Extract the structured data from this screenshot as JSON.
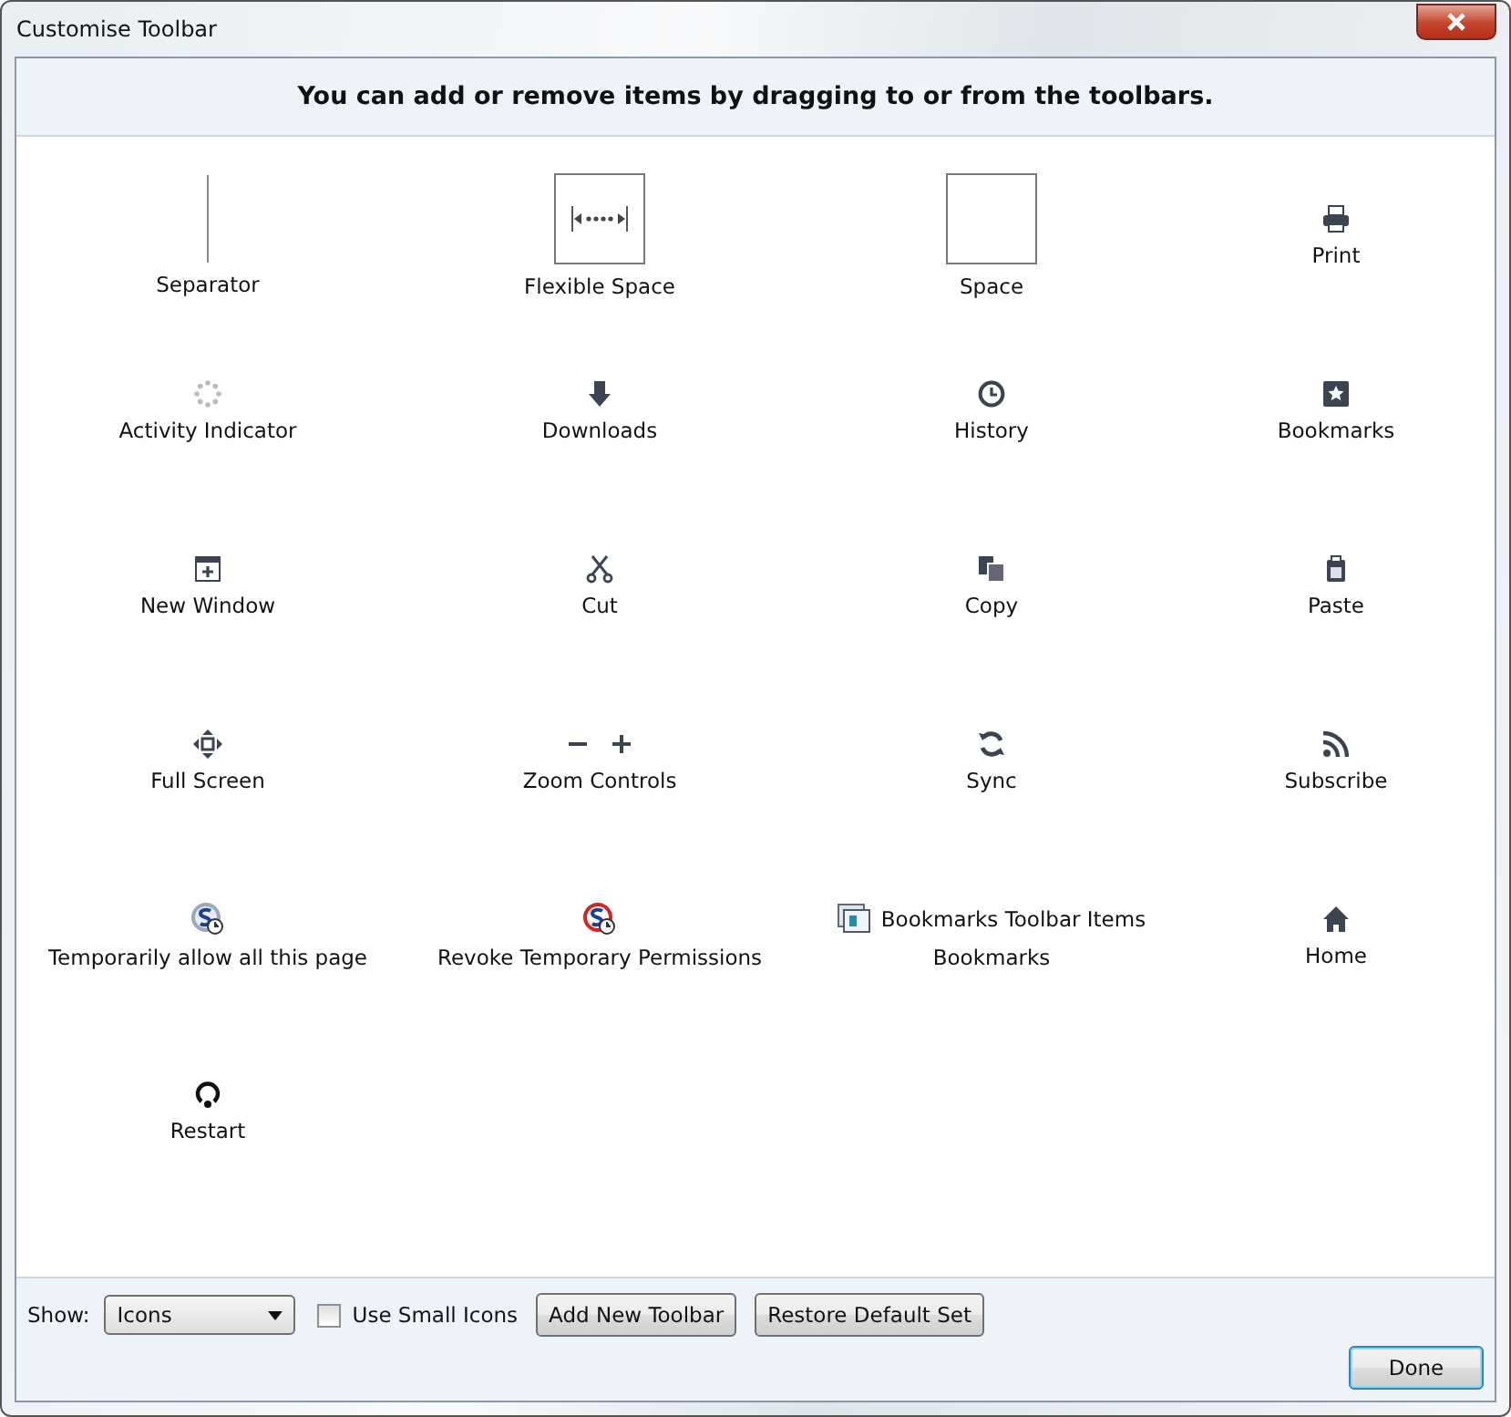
{
  "window": {
    "title": "Customise Toolbar"
  },
  "instructions": "You can add or remove items by dragging to or from the toolbars.",
  "items": [
    {
      "kind": "separator",
      "label": "Separator"
    },
    {
      "kind": "flexible-space",
      "label": "Flexible Space"
    },
    {
      "kind": "space",
      "label": "Space"
    },
    {
      "kind": "print",
      "label": "Print"
    },
    {
      "kind": "spinner",
      "label": "Activity Indicator"
    },
    {
      "kind": "download",
      "label": "Downloads"
    },
    {
      "kind": "clock",
      "label": "History"
    },
    {
      "kind": "star",
      "label": "Bookmarks"
    },
    {
      "kind": "new-window",
      "label": "New Window"
    },
    {
      "kind": "scissors",
      "label": "Cut"
    },
    {
      "kind": "copy",
      "label": "Copy"
    },
    {
      "kind": "paste",
      "label": "Paste"
    },
    {
      "kind": "fullscreen",
      "label": "Full Screen"
    },
    {
      "kind": "zoom",
      "label": "Zoom Controls"
    },
    {
      "kind": "sync",
      "label": "Sync"
    },
    {
      "kind": "feed",
      "label": "Subscribe"
    },
    {
      "kind": "script-allow",
      "label": "Temporarily allow all this page"
    },
    {
      "kind": "script-revoke",
      "label": "Revoke Temporary Permissions"
    },
    {
      "kind": "bookmarks-toolbar",
      "label": "Bookmarks Toolbar Items",
      "sublabel": "Bookmarks"
    },
    {
      "kind": "home",
      "label": "Home"
    },
    {
      "kind": "restart",
      "label": "Restart"
    }
  ],
  "footer": {
    "show_label": "Show:",
    "show_value": "Icons",
    "small_icons": {
      "label": "Use Small Icons",
      "checked": false
    },
    "buttons": [
      "Add New Toolbar",
      "Restore Default Set"
    ],
    "done": "Done"
  }
}
